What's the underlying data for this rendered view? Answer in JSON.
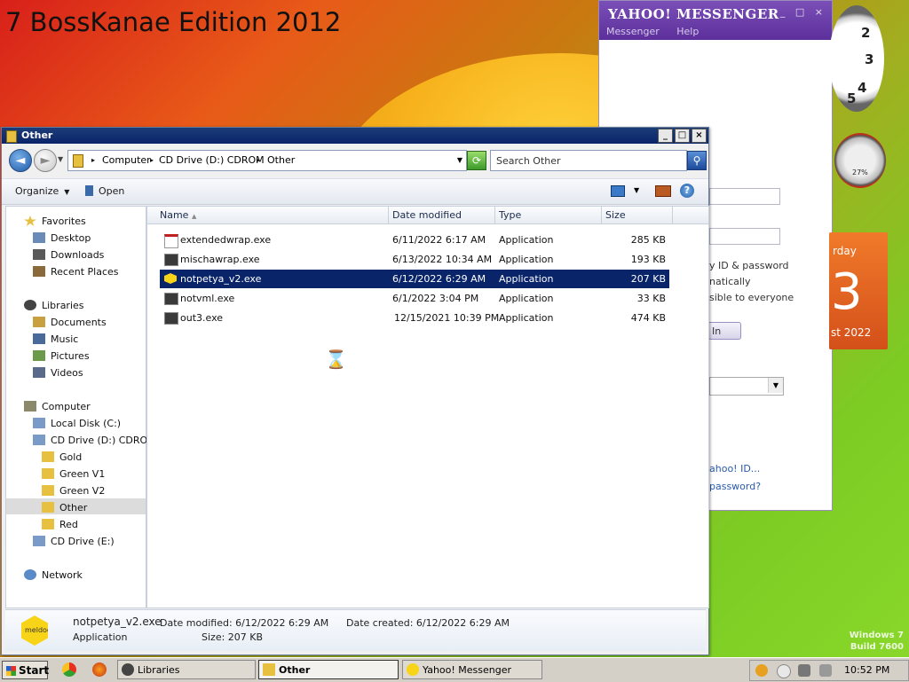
{
  "desktop": {
    "title": "7 BossKanae Edition 2012",
    "watermark_line1": "Windows 7",
    "watermark_line2": "Build 7600"
  },
  "yahoo": {
    "title": "YAHOO! MESSENGER",
    "window_buttons": "_ □ ×",
    "menu": [
      "Messenger",
      "Help"
    ],
    "remember": "y ID & password",
    "auto": "natically",
    "visible": "sible to everyone",
    "signin": "In",
    "link1": "ahoo! ID...",
    "link2": "password?"
  },
  "gadgets": {
    "cpu": "27%",
    "calendar_day": "rday",
    "calendar_num": "3",
    "calendar_month": "st 2022"
  },
  "explorer": {
    "title": "Other",
    "window_buttons": [
      "_",
      "□",
      "×"
    ],
    "address": [
      {
        "label": "Computer"
      },
      {
        "label": "CD Drive (D:) CDROM"
      },
      {
        "label": "Other"
      }
    ],
    "search_placeholder": "Search Other",
    "toolbar": {
      "organize": "Organize",
      "open": "Open"
    },
    "nav": {
      "favorites": "Favorites",
      "desktop": "Desktop",
      "downloads": "Downloads",
      "recent": "Recent Places",
      "libraries": "Libraries",
      "documents": "Documents",
      "music": "Music",
      "pictures": "Pictures",
      "videos": "Videos",
      "computer": "Computer",
      "local_disk": "Local Disk (C:)",
      "cd_d": "CD Drive (D:) CDROM",
      "gold": "Gold",
      "green1": "Green V1",
      "green2": "Green V2",
      "other": "Other",
      "red": "Red",
      "cd_e": "CD Drive (E:)",
      "network": "Network"
    },
    "columns": {
      "name": "Name",
      "date": "Date modified",
      "type": "Type",
      "size": "Size"
    },
    "files": [
      {
        "name": "extendedwrap.exe",
        "date": "6/11/2022 6:17 AM",
        "type": "Application",
        "size": "285 KB"
      },
      {
        "name": "mischawrap.exe",
        "date": "6/13/2022 10:34 AM",
        "type": "Application",
        "size": "193 KB"
      },
      {
        "name": "notpetya_v2.exe",
        "date": "6/12/2022 6:29 AM",
        "type": "Application",
        "size": "207 KB"
      },
      {
        "name": "notvml.exe",
        "date": "6/1/2022 3:04 PM",
        "type": "Application",
        "size": "33 KB"
      },
      {
        "name": "out3.exe",
        "date": "12/15/2021 10:39 PM",
        "type": "Application",
        "size": "474 KB"
      }
    ],
    "details": {
      "filename": "notpetya_v2.exe",
      "type": "Application",
      "modified": "Date modified: 6/12/2022 6:29 AM",
      "size": "Size: 207 KB",
      "created": "Date created: 6/12/2022 6:29 AM",
      "logo_text": "meldoc"
    }
  },
  "taskbar": {
    "start": "Start",
    "tasks": [
      {
        "label": "Libraries"
      },
      {
        "label": "Other"
      },
      {
        "label": "Yahoo! Messenger"
      }
    ],
    "clock": "10:52 PM"
  }
}
